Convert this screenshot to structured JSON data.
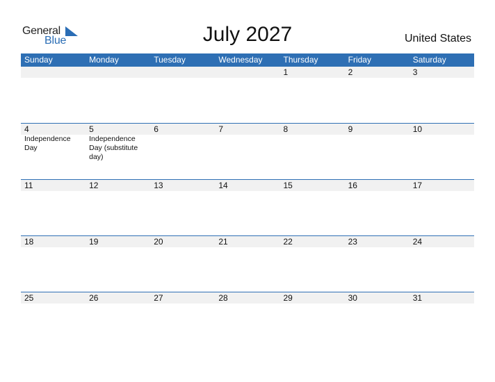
{
  "logo": {
    "general": "General",
    "blue": "Blue",
    "accent": "#2a6db5"
  },
  "title": "July 2027",
  "country": "United States",
  "colors": {
    "header_bg": "#2e6fb4",
    "date_strip_bg": "#f1f1f1"
  },
  "weekdays": [
    "Sunday",
    "Monday",
    "Tuesday",
    "Wednesday",
    "Thursday",
    "Friday",
    "Saturday"
  ],
  "weeks": [
    {
      "days": [
        "",
        "",
        "",
        "",
        "1",
        "2",
        "3"
      ],
      "events": [
        "",
        "",
        "",
        "",
        "",
        "",
        ""
      ]
    },
    {
      "days": [
        "4",
        "5",
        "6",
        "7",
        "8",
        "9",
        "10"
      ],
      "events": [
        "Independence Day",
        "Independence Day (substitute day)",
        "",
        "",
        "",
        "",
        ""
      ]
    },
    {
      "days": [
        "11",
        "12",
        "13",
        "14",
        "15",
        "16",
        "17"
      ],
      "events": [
        "",
        "",
        "",
        "",
        "",
        "",
        ""
      ]
    },
    {
      "days": [
        "18",
        "19",
        "20",
        "21",
        "22",
        "23",
        "24"
      ],
      "events": [
        "",
        "",
        "",
        "",
        "",
        "",
        ""
      ]
    },
    {
      "days": [
        "25",
        "26",
        "27",
        "28",
        "29",
        "30",
        "31"
      ],
      "events": [
        "",
        "",
        "",
        "",
        "",
        "",
        ""
      ]
    }
  ]
}
